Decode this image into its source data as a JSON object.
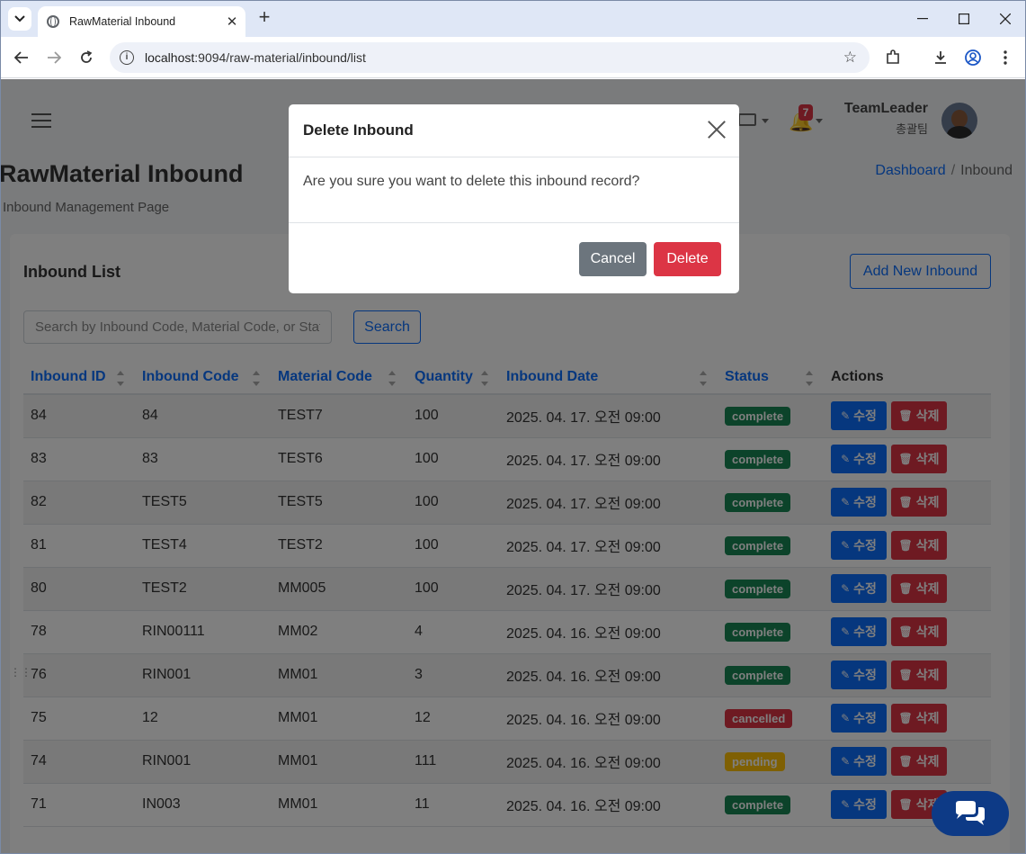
{
  "browser": {
    "tab_title": "RawMaterial Inbound",
    "url_host": "localhost",
    "url_rest": ":9094/raw-material/inbound/list"
  },
  "header": {
    "user_name": "TeamLeader",
    "user_team": "총괄팀",
    "notification_count": "7"
  },
  "page": {
    "title": "RawMaterial Inbound",
    "subtitle": "Inbound Management Page",
    "breadcrumb": [
      "Dashboard",
      "Inbound"
    ]
  },
  "card": {
    "title": "Inbound List",
    "add_label": "Add New Inbound",
    "search_placeholder": "Search by Inbound Code, Material Code, or Status",
    "search_label": "Search"
  },
  "table": {
    "columns": [
      "Inbound ID",
      "Inbound Code",
      "Material Code",
      "Quantity",
      "Inbound Date",
      "Status",
      "Actions"
    ],
    "edit_label": "수정",
    "delete_label": "삭제",
    "rows": [
      {
        "id": "84",
        "code": "84",
        "material": "TEST7",
        "qty": "100",
        "date": "2025. 04. 17. 오전 09:00",
        "status": "complete"
      },
      {
        "id": "83",
        "code": "83",
        "material": "TEST6",
        "qty": "100",
        "date": "2025. 04. 17. 오전 09:00",
        "status": "complete"
      },
      {
        "id": "82",
        "code": "TEST5",
        "material": "TEST5",
        "qty": "100",
        "date": "2025. 04. 17. 오전 09:00",
        "status": "complete"
      },
      {
        "id": "81",
        "code": "TEST4",
        "material": "TEST2",
        "qty": "100",
        "date": "2025. 04. 17. 오전 09:00",
        "status": "complete"
      },
      {
        "id": "80",
        "code": "TEST2",
        "material": "MM005",
        "qty": "100",
        "date": "2025. 04. 17. 오전 09:00",
        "status": "complete"
      },
      {
        "id": "78",
        "code": "RIN00111",
        "material": "MM02",
        "qty": "4",
        "date": "2025. 04. 16. 오전 09:00",
        "status": "complete"
      },
      {
        "id": "76",
        "code": "RIN001",
        "material": "MM01",
        "qty": "3",
        "date": "2025. 04. 16. 오전 09:00",
        "status": "complete"
      },
      {
        "id": "75",
        "code": "12",
        "material": "MM01",
        "qty": "12",
        "date": "2025. 04. 16. 오전 09:00",
        "status": "cancelled"
      },
      {
        "id": "74",
        "code": "RIN001",
        "material": "MM01",
        "qty": "111",
        "date": "2025. 04. 16. 오전 09:00",
        "status": "pending"
      },
      {
        "id": "71",
        "code": "IN003",
        "material": "MM01",
        "qty": "11",
        "date": "2025. 04. 16. 오전 09:00",
        "status": "complete"
      }
    ]
  },
  "modal": {
    "title": "Delete Inbound",
    "body": "Are you sure you want to delete this inbound record?",
    "cancel_label": "Cancel",
    "delete_label": "Delete"
  },
  "colors": {
    "primary": "#0d6efd",
    "danger": "#dc3545",
    "success": "#198754",
    "warning": "#ffc107"
  }
}
